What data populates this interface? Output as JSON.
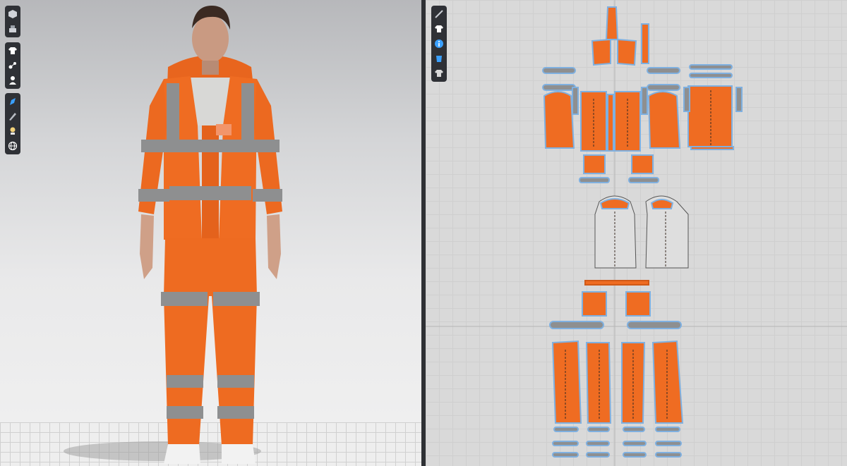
{
  "app": {
    "accent_color": "#f26a21",
    "reflective_color": "#8e8f90",
    "toolbar_color": "#2f3136",
    "outline_color": "#7fb0e0"
  },
  "view3d": {
    "toolbar_groups": [
      [
        "cube-icon",
        "stack-icon"
      ],
      [
        "shirt-icon",
        "points-icon",
        "person-icon"
      ],
      [
        "brush-icon",
        "pen-icon",
        "light-icon",
        "globe-icon"
      ]
    ]
  },
  "view2d": {
    "toolbar_icons": [
      "needle-icon",
      "shirt-icon",
      "info-icon",
      "cup-icon",
      "shirt-alt-icon"
    ]
  }
}
